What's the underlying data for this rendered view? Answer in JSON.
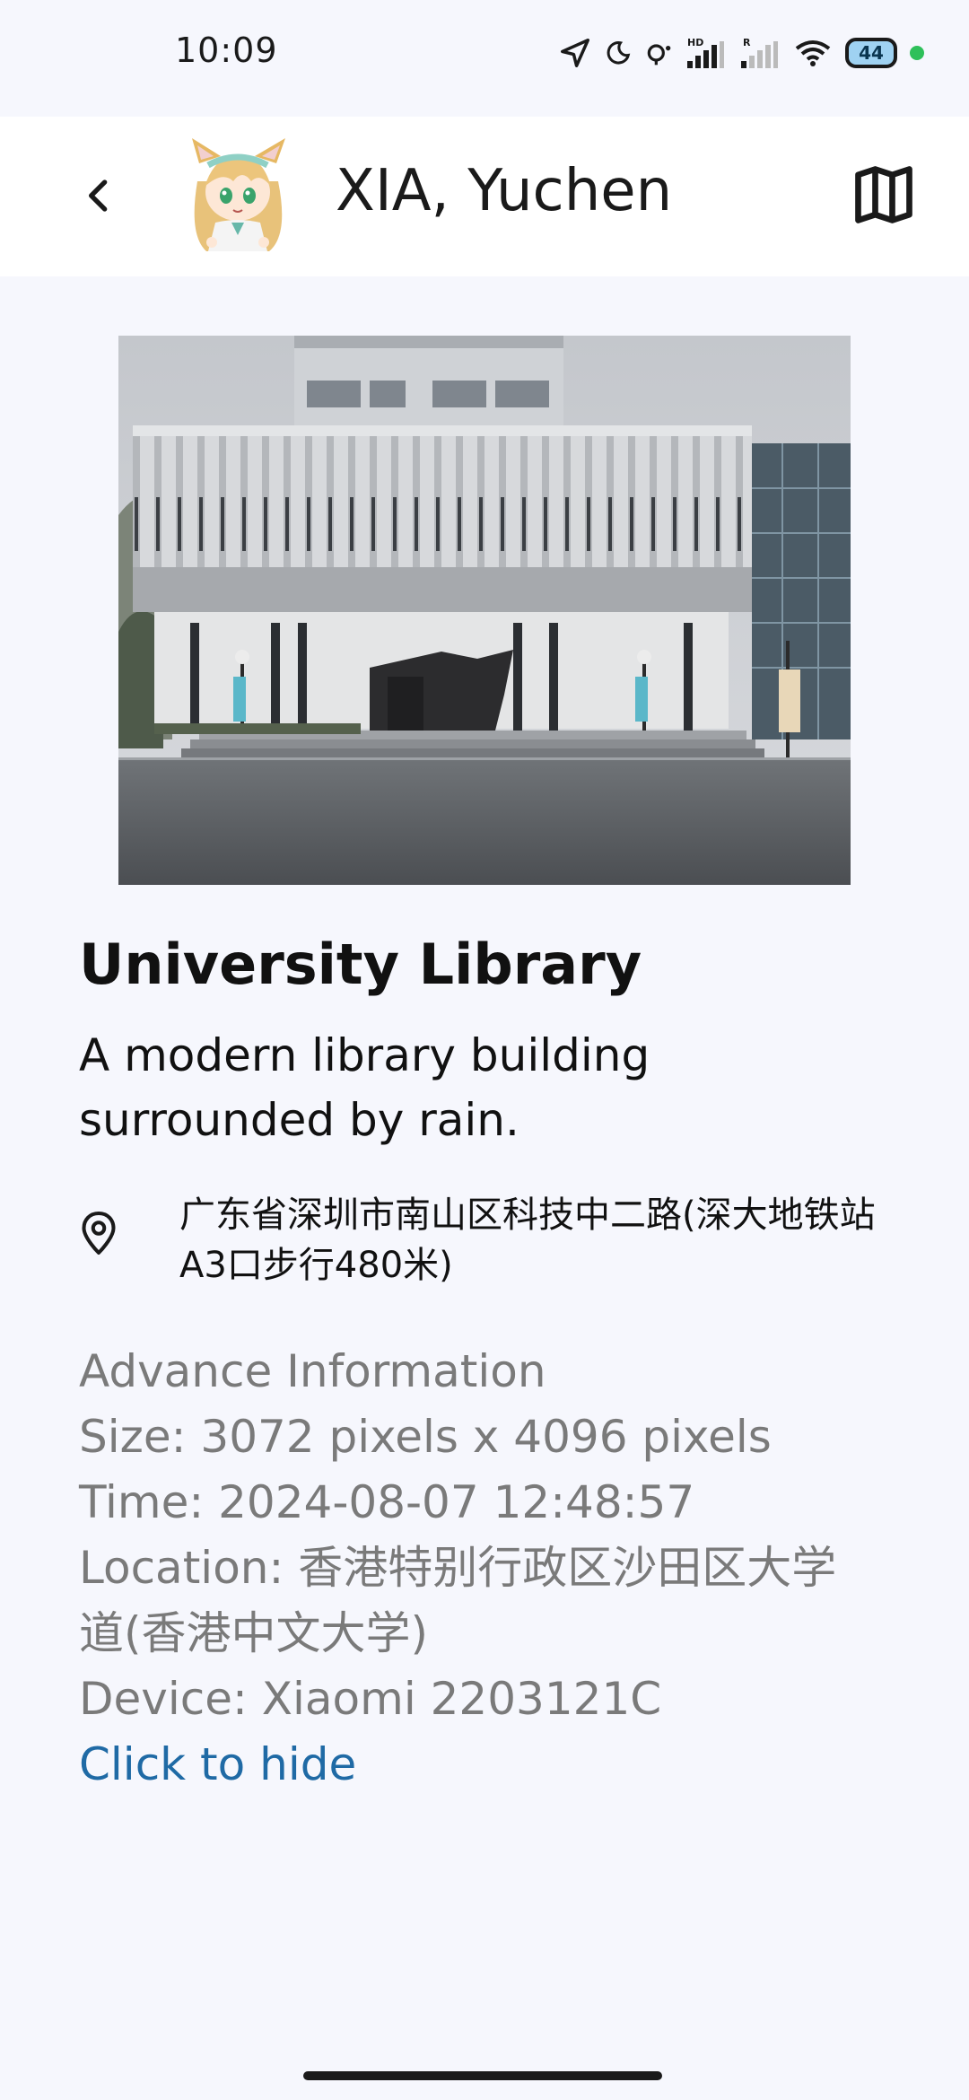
{
  "status_bar": {
    "time": "10:09",
    "battery": "44"
  },
  "header": {
    "user_name": "XIA, Yuchen",
    "back_icon": "chevron-left-icon",
    "map_icon": "map-icon"
  },
  "place": {
    "title": "University Library",
    "description": "A modern library building surrounded by rain.",
    "address": "广东省深圳市南山区科技中二路(深大地铁站A3口步行480米)"
  },
  "advance": {
    "heading": "Advance Information",
    "size": "Size: 3072 pixels x 4096 pixels",
    "time": "Time: 2024-08-07 12:48:57",
    "location": "Location: 香港特别行政区沙田区大学道(香港中文大学)",
    "device": "Device: Xiaomi 2203121C",
    "hide_label": "Click to hide"
  },
  "colors": {
    "background": "#f6f7fd",
    "link": "#1f6aa5",
    "muted_text": "#7a7a7a"
  }
}
